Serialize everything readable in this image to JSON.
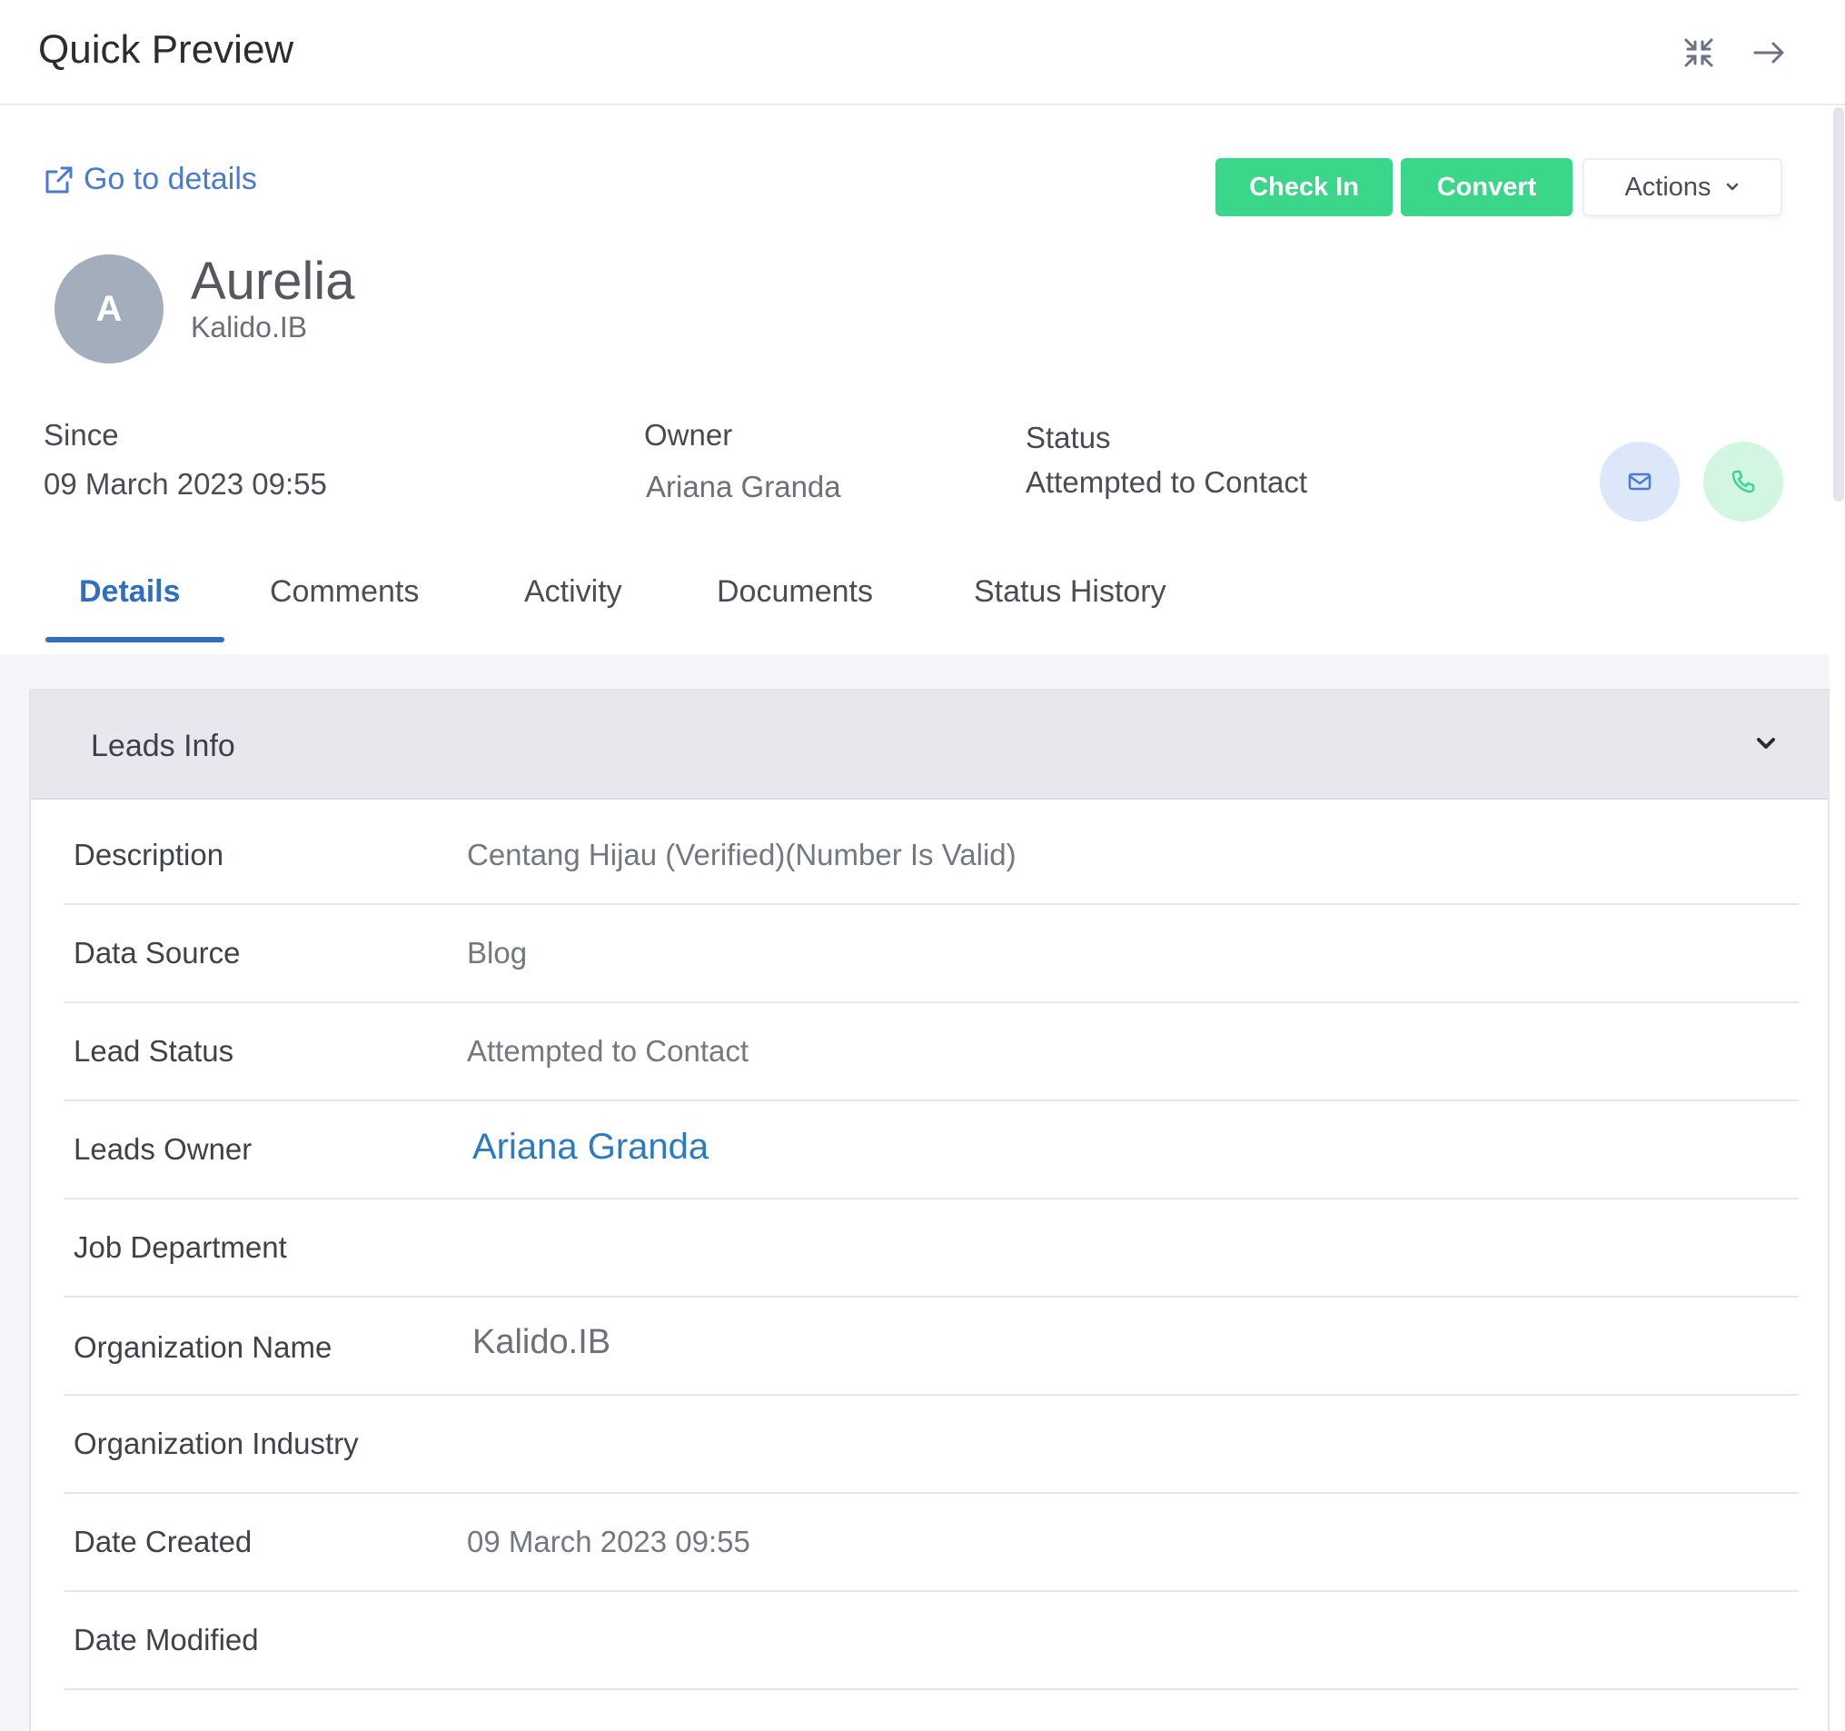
{
  "header": {
    "title": "Quick Preview",
    "icons": [
      "collapse-icon",
      "arrow-right-icon"
    ]
  },
  "toolbar": {
    "go_to_details": "Go to details",
    "check_in": "Check In",
    "convert": "Convert",
    "actions": "Actions"
  },
  "lead": {
    "avatar_initial": "A",
    "name": "Aurelia",
    "organization": "Kalido.IB"
  },
  "meta": {
    "since_label": "Since",
    "since_value": "09 March 2023 09:55",
    "owner_label": "Owner",
    "owner_value": "Ariana Granda",
    "status_label": "Status",
    "status_value": "Attempted to Contact"
  },
  "tabs": [
    {
      "label": "Details",
      "active": true
    },
    {
      "label": "Comments",
      "active": false
    },
    {
      "label": "Activity",
      "active": false
    },
    {
      "label": "Documents",
      "active": false
    },
    {
      "label": "Status History",
      "active": false
    }
  ],
  "leads_info": {
    "title": "Leads Info",
    "rows": [
      {
        "label": "Description",
        "value": "Centang Hijau (Verified)(Number Is Valid)"
      },
      {
        "label": "Data Source",
        "value": "Blog"
      },
      {
        "label": "Lead Status",
        "value": "Attempted to Contact"
      },
      {
        "label": "Leads Owner",
        "value": "Ariana Granda"
      },
      {
        "label": "Job Department",
        "value": ""
      },
      {
        "label": "Organization Name",
        "value": "Kalido.IB"
      },
      {
        "label": "Organization Industry",
        "value": ""
      },
      {
        "label": "Date Created",
        "value": "09 March 2023 09:55"
      },
      {
        "label": "Date Modified",
        "value": ""
      }
    ]
  },
  "colors": {
    "accent_blue": "#2e6fc2",
    "success_green": "#3ad68a",
    "link_blue": "#2a7bc4"
  }
}
